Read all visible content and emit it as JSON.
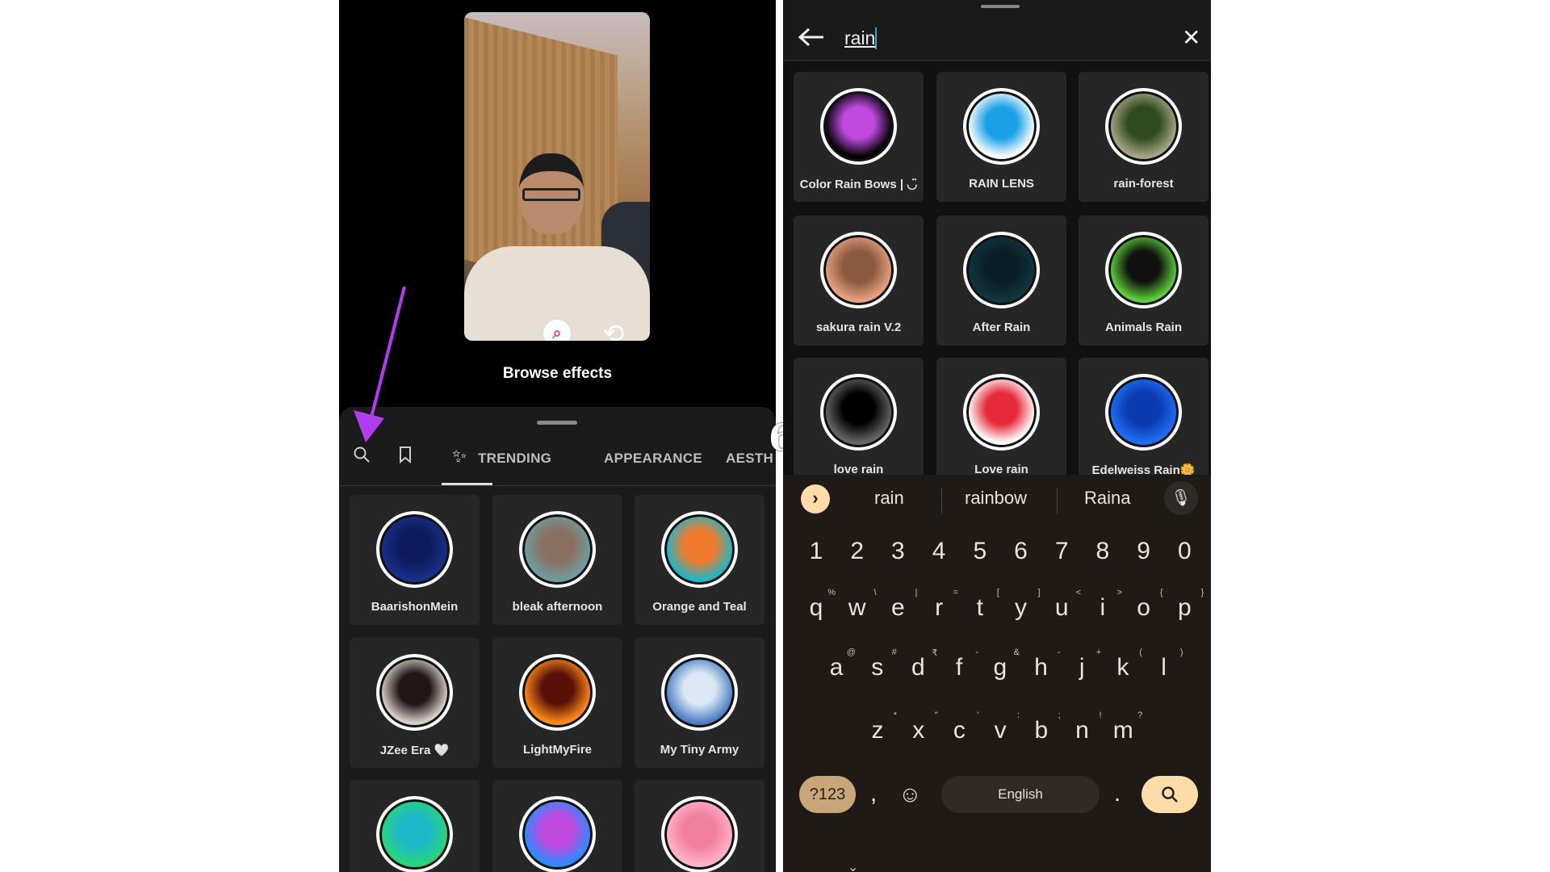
{
  "left_screen": {
    "browse_effects": "Browse effects",
    "tabs": [
      {
        "label": "TRENDING"
      },
      {
        "label": "APPEARANCE"
      },
      {
        "label": "AESTH"
      }
    ],
    "tab_icons": [
      "search-icon",
      "bookmark-icon",
      "sparkles-icon"
    ],
    "active_tab": "sparkles-icon",
    "effects": [
      {
        "label": "BaarishonMein",
        "colors": [
          "#1b2f8a",
          "#0d1a5e"
        ]
      },
      {
        "label": "bleak afternoon",
        "colors": [
          "#6f9ca0",
          "#8a7060"
        ]
      },
      {
        "label": "Orange and Teal",
        "colors": [
          "#1fb6c9",
          "#f07a2c"
        ]
      },
      {
        "label": "JZee Era 🤍",
        "colors": [
          "#d8cfc8",
          "#201818"
        ]
      },
      {
        "label": "LightMyFire",
        "colors": [
          "#ff8a1a",
          "#5a1208"
        ]
      },
      {
        "label": "My Tiny Army",
        "colors": [
          "#4d7fc4",
          "#dce8f5"
        ]
      },
      {
        "label": "",
        "colors": [
          "#28d47a",
          "#20b8c8"
        ]
      },
      {
        "label": "",
        "colors": [
          "#2a8cff",
          "#c04ae0"
        ]
      },
      {
        "label": "",
        "colors": [
          "#ffb3c6",
          "#f27ea0"
        ]
      }
    ],
    "annotation_arrow_color": "#b23cf0"
  },
  "stray_text": "6",
  "right_screen": {
    "search": {
      "value": "rain"
    },
    "results": [
      {
        "label": "Color Rain Bows | ◡̈",
        "colors": [
          "#000000",
          "#c04ae0"
        ]
      },
      {
        "label": "RAIN LENS",
        "colors": [
          "#ffffff",
          "#1aa0e6"
        ]
      },
      {
        "label": "rain-forest",
        "colors": [
          "#a8a488",
          "#2e4a1e"
        ]
      },
      {
        "label": "sakura rain V.2",
        "colors": [
          "#e8a080",
          "#8a5a40"
        ]
      },
      {
        "label": "After Rain",
        "colors": [
          "#123540",
          "#0a1e26"
        ]
      },
      {
        "label": "Animals Rain",
        "colors": [
          "#5fcf3a",
          "#101010"
        ]
      },
      {
        "label": "love rain",
        "colors": [
          "#666666",
          "#000000"
        ]
      },
      {
        "label": "Love rain",
        "colors": [
          "#ffffff",
          "#e62a3a"
        ]
      },
      {
        "label": "Edelweiss Rain🌼",
        "colors": [
          "#1f6ef0",
          "#0a3ab0"
        ]
      }
    ],
    "keyboard": {
      "suggestions": [
        "rain",
        "rainbow",
        "Raina"
      ],
      "numbers": [
        "1",
        "2",
        "3",
        "4",
        "5",
        "6",
        "7",
        "8",
        "9",
        "0"
      ],
      "row1": [
        [
          "q",
          "%"
        ],
        [
          "w",
          "\\"
        ],
        [
          "e",
          "|"
        ],
        [
          "r",
          "="
        ],
        [
          "t",
          "["
        ],
        [
          "y",
          "]"
        ],
        [
          "u",
          "<"
        ],
        [
          "i",
          ">"
        ],
        [
          "o",
          "{"
        ],
        [
          "p",
          "}"
        ]
      ],
      "row2": [
        [
          "a",
          "@"
        ],
        [
          "s",
          "#"
        ],
        [
          "d",
          "₹"
        ],
        [
          "f",
          "-"
        ],
        [
          "g",
          "&"
        ],
        [
          "h",
          "-"
        ],
        [
          "j",
          "+"
        ],
        [
          "k",
          "("
        ],
        [
          "l",
          ")"
        ]
      ],
      "row3": [
        [
          "z",
          "*"
        ],
        [
          "x",
          "\""
        ],
        [
          "c",
          "'"
        ],
        [
          "v",
          ":"
        ],
        [
          "b",
          ";"
        ],
        [
          "n",
          "!"
        ],
        [
          "m",
          "?"
        ]
      ],
      "symbols_key": "?123",
      "comma": ",",
      "period": ".",
      "space_label": "English",
      "accent": "#ffdca8",
      "symbols_bg": "#c9a57a"
    }
  }
}
